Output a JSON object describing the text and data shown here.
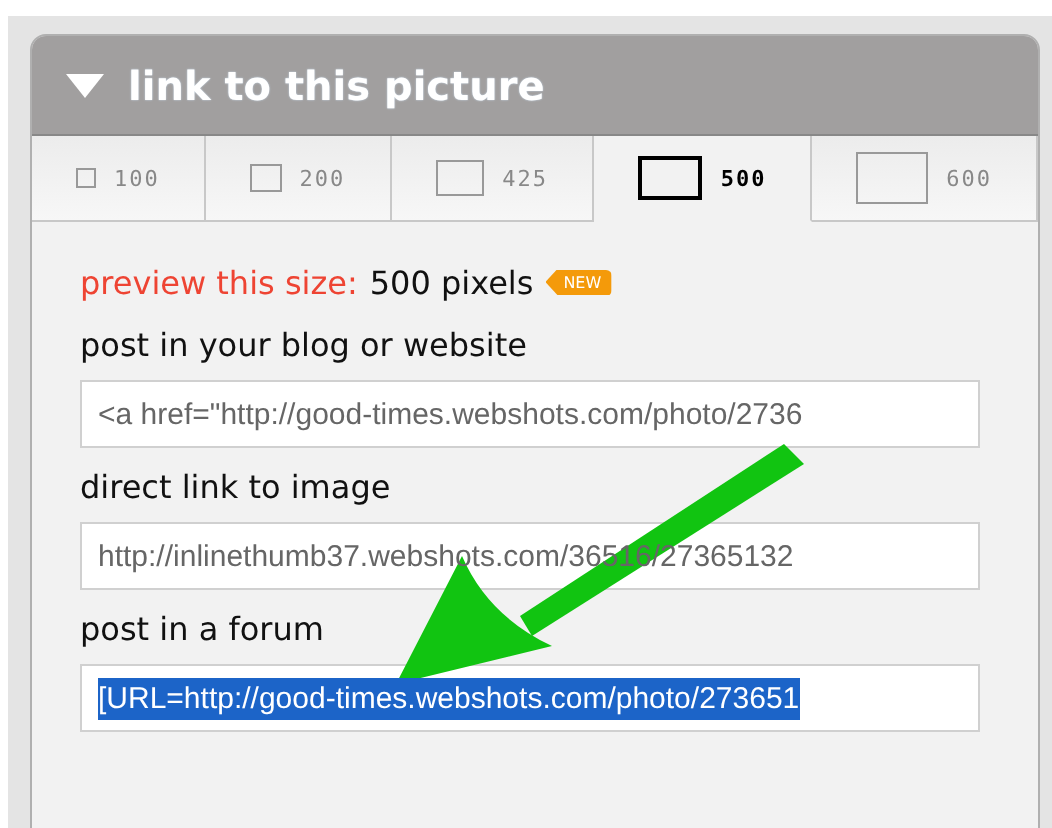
{
  "panel": {
    "title": "link to this picture",
    "expanded": true
  },
  "tabs": [
    {
      "label": "100",
      "selected": false
    },
    {
      "label": "200",
      "selected": false
    },
    {
      "label": "425",
      "selected": false
    },
    {
      "label": "500",
      "selected": true
    },
    {
      "label": "600",
      "selected": false
    }
  ],
  "preview": {
    "label": "preview this size:",
    "value": "500 pixels",
    "badge": "NEW"
  },
  "fields": [
    {
      "label": "post in your blog or website",
      "value": "<a href=\"http://good-times.webshots.com/photo/2736",
      "selected": false
    },
    {
      "label": "direct link to image",
      "value": "http://inlinethumb37.webshots.com/36516/27365132",
      "selected": false
    },
    {
      "label": "post in a forum",
      "value": "[URL=http://good-times.webshots.com/photo/273651",
      "selected": true
    }
  ]
}
